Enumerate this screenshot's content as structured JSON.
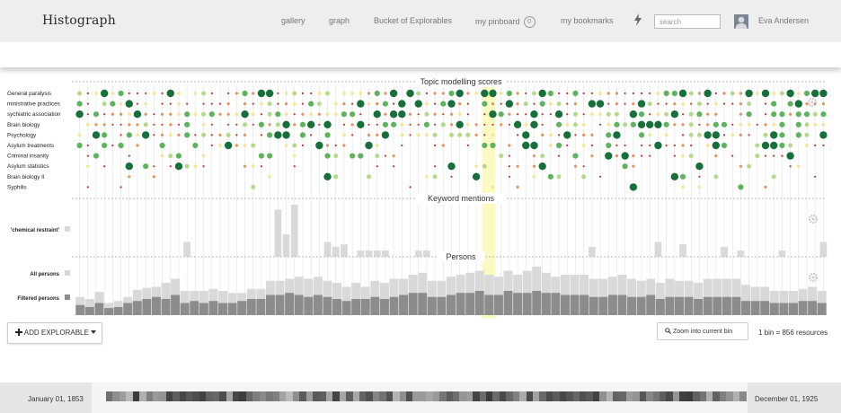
{
  "header": {
    "title": "Histograph",
    "nav": [
      "gallery",
      "graph",
      "Bucket of Explorables",
      "my pinboard",
      "my bookmarks"
    ],
    "pin_count": "0",
    "search_placeholder": "search",
    "user_name": "Eva Andersen"
  },
  "sections": {
    "topics_title": "Topic modelling scores",
    "keywords_title": "Keyword mentions",
    "persons_title": "Persons"
  },
  "topics": [
    "General paralysis",
    "ministrative practices",
    "sychiatric association",
    "Brain biology",
    "Psychology",
    "Asylum treatments",
    "Criminal insanity",
    "Asylum statistics",
    "Brain biology II",
    "Syphilis"
  ],
  "keyword_label": "'chemical restraint'",
  "person_labels": {
    "all": "All persons",
    "filtered": "Filtered persons"
  },
  "keyword_values": [
    0,
    0,
    0,
    0,
    0,
    0,
    0,
    0,
    0,
    0,
    0,
    0,
    0,
    12,
    0,
    0,
    0,
    0,
    0,
    0,
    0,
    0,
    0,
    0,
    38,
    18,
    42,
    0,
    0,
    0,
    12,
    8,
    10,
    0,
    5,
    5,
    5,
    5,
    0,
    0,
    0,
    5,
    5,
    0,
    0,
    0,
    0,
    0,
    0,
    0,
    0,
    0,
    0,
    0,
    0,
    0,
    0,
    0,
    0,
    0,
    0,
    0,
    8,
    0,
    0,
    0,
    0,
    0,
    0,
    0,
    12,
    0,
    0,
    10,
    0,
    0,
    0,
    0,
    8,
    0,
    5,
    0,
    0,
    0,
    0,
    5,
    0,
    0,
    0,
    0,
    12
  ],
  "all_persons": [
    18,
    16,
    23,
    12,
    14,
    18,
    25,
    27,
    28,
    32,
    36,
    24,
    24,
    24,
    26,
    24,
    22,
    22,
    26,
    26,
    34,
    34,
    36,
    38,
    36,
    38,
    34,
    32,
    28,
    32,
    28,
    34,
    32,
    36,
    36,
    40,
    42,
    34,
    34,
    38,
    40,
    42,
    44,
    40,
    38,
    44,
    40,
    44,
    48,
    42,
    38,
    40,
    40,
    40,
    36,
    36,
    38,
    40,
    36,
    34,
    36,
    32,
    36,
    34,
    34,
    32,
    36,
    36,
    36,
    36,
    30,
    28,
    28,
    24,
    24,
    24,
    26,
    28,
    24
  ],
  "filtered_persons": [
    10,
    8,
    12,
    7,
    8,
    12,
    14,
    16,
    18,
    16,
    20,
    12,
    14,
    12,
    14,
    12,
    12,
    14,
    16,
    16,
    20,
    20,
    22,
    20,
    18,
    20,
    18,
    16,
    14,
    16,
    16,
    18,
    16,
    18,
    20,
    22,
    22,
    18,
    18,
    20,
    22,
    22,
    24,
    20,
    20,
    24,
    22,
    22,
    24,
    22,
    22,
    20,
    20,
    20,
    18,
    18,
    20,
    20,
    18,
    18,
    20,
    16,
    18,
    18,
    18,
    16,
    18,
    18,
    18,
    18,
    14,
    14,
    14,
    12,
    12,
    12,
    14,
    14,
    12
  ],
  "controls": {
    "add_explorable": "ADD EXPLORABLE",
    "zoom": "Zoom into current bin",
    "bin_info": "1 bin = 856 resources"
  },
  "timeline": {
    "start": "January 01, 1853",
    "end": "December 01, 1925"
  },
  "colors": {
    "header_bg": "#eeeeee",
    "highlight": "#fbf9b8",
    "dark_green": "#17703a",
    "bar_all": "#d9d9d9",
    "bar_filtered": "#8c8c8c"
  },
  "icons": [
    "lightning-icon",
    "avatar-icon",
    "gear-icon",
    "plus-icon",
    "caret-down-icon",
    "zoom-icon"
  ]
}
